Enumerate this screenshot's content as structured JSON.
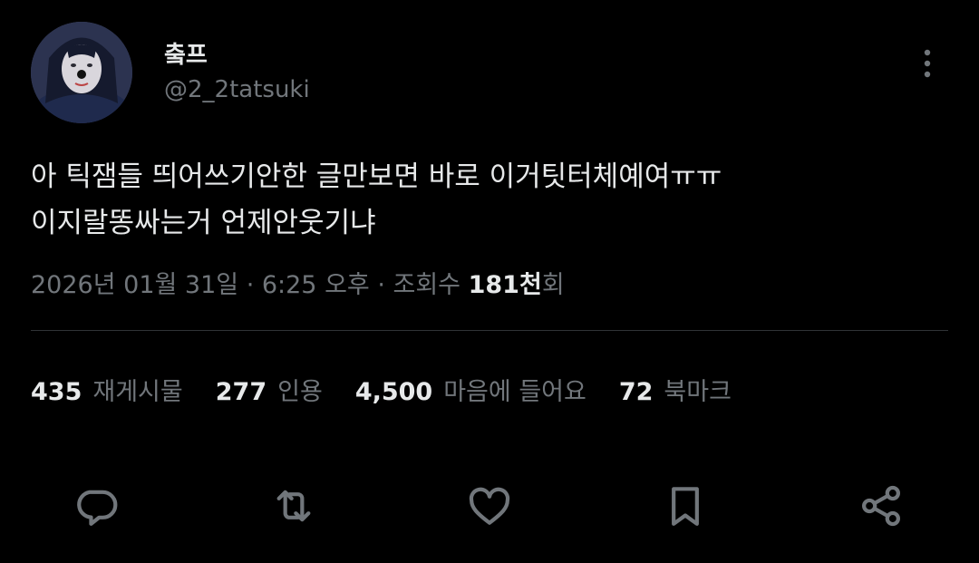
{
  "user": {
    "display_name": "춬프",
    "handle": "@2_2tatsuki"
  },
  "tweet": {
    "lines": [
      "아 틱잼들 띄어쓰기안한 글만보면 바로 이거팃터체예여ㅠㅠ",
      "이지랄똥싸는거 언제안웃기냐"
    ]
  },
  "meta": {
    "timestamp": "2026년 01월 31일 · 6:25 오후 · 조회수 ",
    "views_count": "181천",
    "views_suffix": "회"
  },
  "stats": {
    "reposts": {
      "count": "435",
      "label": "재게시물"
    },
    "quotes": {
      "count": "277",
      "label": "인용"
    },
    "likes": {
      "count": "4,500",
      "label": "마음에 들어요"
    },
    "bookmarks": {
      "count": "72",
      "label": "북마크"
    }
  },
  "icons": {
    "more": "more-vertical-icon",
    "reply": "reply-icon",
    "repost": "repost-icon",
    "like": "heart-icon",
    "bookmark": "bookmark-icon",
    "share": "share-icon"
  },
  "colors": {
    "background": "#000000",
    "primary_text": "#e7e9ea",
    "secondary_text": "#71767b",
    "divider": "#2f3336"
  }
}
